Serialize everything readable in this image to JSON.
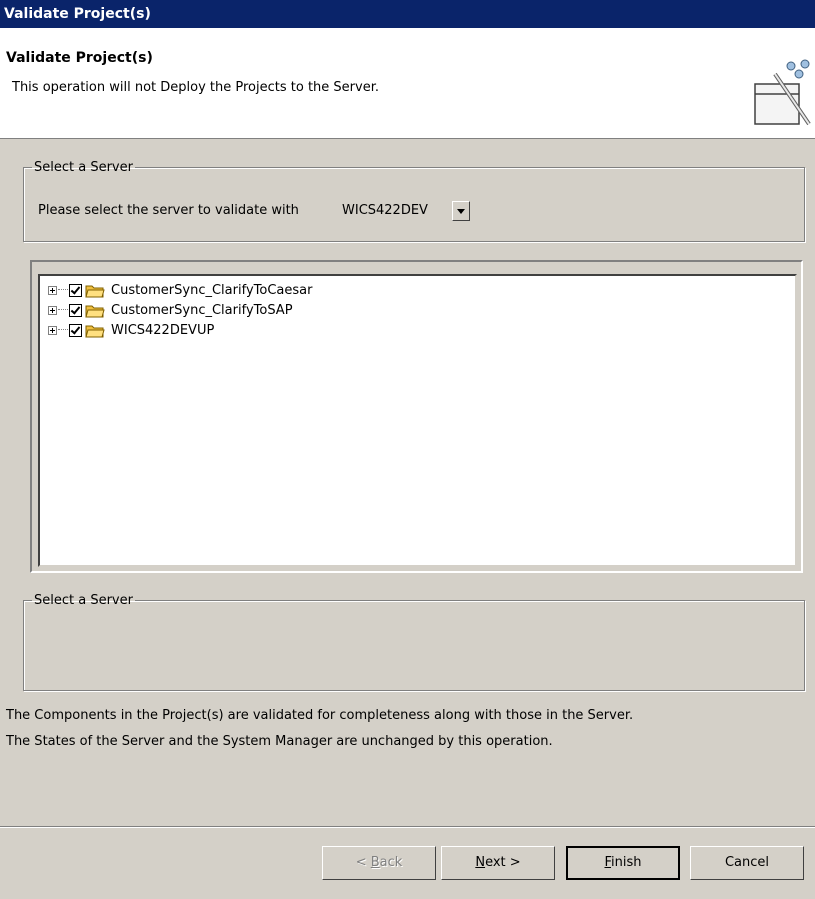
{
  "window": {
    "title": "Validate Project(s)"
  },
  "header": {
    "title": "Validate Project(s)",
    "description": "This operation will not Deploy the Projects to the Server."
  },
  "server_group": {
    "legend": "Select a Server",
    "label": "Please select the server to validate with",
    "selected_server": "WICS422DEV"
  },
  "tree": {
    "items": [
      {
        "label": "CustomerSync_ClarifyToCaesar",
        "checked": true
      },
      {
        "label": "CustomerSync_ClarifyToSAP",
        "checked": true
      },
      {
        "label": "WICS422DEVUP",
        "checked": true
      }
    ]
  },
  "details_group": {
    "legend": "Select a Server"
  },
  "info": {
    "line1": "The Components in the Project(s) are validated for completeness along with those in the Server.",
    "line2": "The States of the Server and the System Manager are unchanged by this operation."
  },
  "buttons": {
    "back": {
      "pre": "< ",
      "mn": "B",
      "post": "ack"
    },
    "next": {
      "pre": "",
      "mn": "N",
      "post": "ext >"
    },
    "finish": {
      "pre": "",
      "mn": "F",
      "post": "inish"
    },
    "cancel": "Cancel"
  },
  "colors": {
    "titlebar": "#0a246a",
    "dialog_bg": "#d4d0c8",
    "folder": "#f0c040"
  }
}
